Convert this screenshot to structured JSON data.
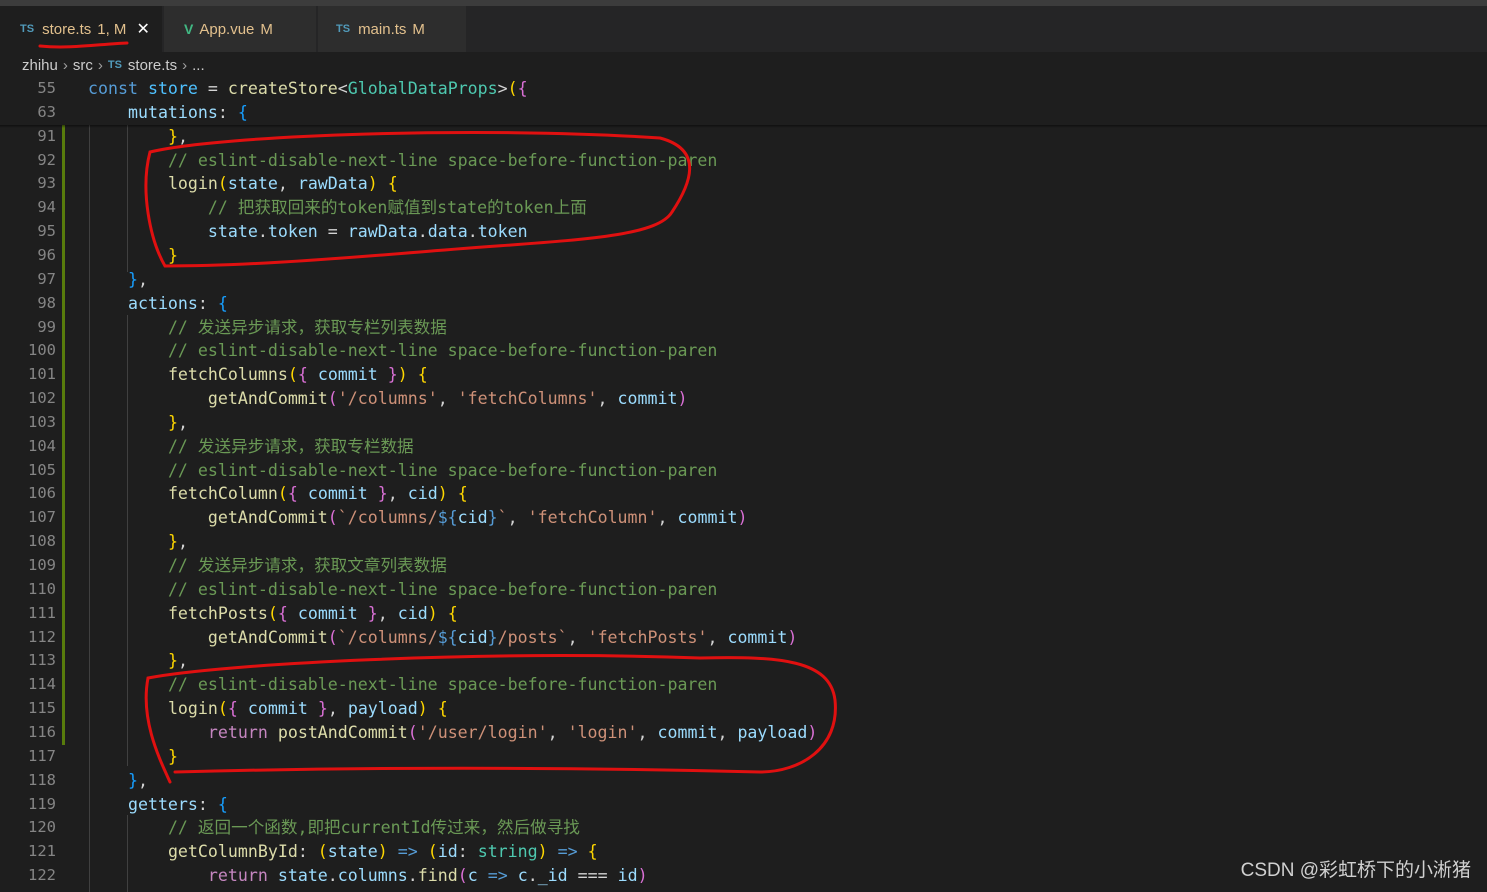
{
  "tabs": [
    {
      "icon": "TS",
      "name": "store.ts",
      "status": "1, M"
    },
    {
      "icon": "V",
      "name": "App.vue",
      "status": "M"
    },
    {
      "icon": "TS",
      "name": "main.ts",
      "status": "M"
    }
  ],
  "breadcrumb": {
    "project": "zhihu",
    "folder": "src",
    "file_icon": "TS",
    "file": "store.ts",
    "more": "..."
  },
  "lines": [
    {
      "n": "55",
      "t": [
        [
          "t-kw",
          "const"
        ],
        [
          "t-p",
          " "
        ],
        [
          "t-const",
          "store"
        ],
        [
          "t-p",
          " = "
        ],
        [
          "t-fn",
          "createStore"
        ],
        [
          "t-p",
          "<"
        ],
        [
          "t-type",
          "GlobalDataProps"
        ],
        [
          "t-p",
          ">"
        ],
        [
          "b1",
          "("
        ],
        [
          "b2",
          "{"
        ]
      ]
    },
    {
      "n": "63",
      "t": [
        [
          "t-p",
          "    "
        ],
        [
          "t-var",
          "mutations"
        ],
        [
          "t-p",
          ": "
        ],
        [
          "b3",
          "{"
        ]
      ]
    },
    {
      "n": "91",
      "t": [
        [
          "t-p",
          "        "
        ],
        [
          "b1",
          "}"
        ],
        [
          "t-p",
          ","
        ]
      ]
    },
    {
      "n": "92",
      "t": [
        [
          "t-p",
          "        "
        ],
        [
          "t-com",
          "// eslint-disable-next-line space-before-function-paren"
        ]
      ]
    },
    {
      "n": "93",
      "t": [
        [
          "t-p",
          "        "
        ],
        [
          "t-fn",
          "login"
        ],
        [
          "b1",
          "("
        ],
        [
          "t-var",
          "state"
        ],
        [
          "t-p",
          ", "
        ],
        [
          "t-var",
          "rawData"
        ],
        [
          "b1",
          ")"
        ],
        [
          "t-p",
          " "
        ],
        [
          "b1",
          "{"
        ]
      ]
    },
    {
      "n": "94",
      "t": [
        [
          "t-p",
          "            "
        ],
        [
          "t-com",
          "// 把获取回来的token赋值到state的token上面"
        ]
      ]
    },
    {
      "n": "95",
      "t": [
        [
          "t-p",
          "            "
        ],
        [
          "t-var",
          "state"
        ],
        [
          "t-p",
          "."
        ],
        [
          "t-var",
          "token"
        ],
        [
          "t-p",
          " = "
        ],
        [
          "t-var",
          "rawData"
        ],
        [
          "t-p",
          "."
        ],
        [
          "t-var",
          "data"
        ],
        [
          "t-p",
          "."
        ],
        [
          "t-var",
          "token"
        ]
      ]
    },
    {
      "n": "96",
      "t": [
        [
          "t-p",
          "        "
        ],
        [
          "b1",
          "}"
        ]
      ]
    },
    {
      "n": "97",
      "t": [
        [
          "t-p",
          "    "
        ],
        [
          "b3",
          "}"
        ],
        [
          "t-p",
          ","
        ]
      ]
    },
    {
      "n": "98",
      "t": [
        [
          "t-p",
          "    "
        ],
        [
          "t-var",
          "actions"
        ],
        [
          "t-p",
          ": "
        ],
        [
          "b3",
          "{"
        ]
      ]
    },
    {
      "n": "99",
      "t": [
        [
          "t-p",
          "        "
        ],
        [
          "t-com",
          "// 发送异步请求，获取专栏列表数据"
        ]
      ]
    },
    {
      "n": "100",
      "t": [
        [
          "t-p",
          "        "
        ],
        [
          "t-com",
          "// eslint-disable-next-line space-before-function-paren"
        ]
      ]
    },
    {
      "n": "101",
      "t": [
        [
          "t-p",
          "        "
        ],
        [
          "t-fn",
          "fetchColumns"
        ],
        [
          "b1",
          "("
        ],
        [
          "b2",
          "{"
        ],
        [
          "t-p",
          " "
        ],
        [
          "t-var",
          "commit"
        ],
        [
          "t-p",
          " "
        ],
        [
          "b2",
          "}"
        ],
        [
          "b1",
          ")"
        ],
        [
          "t-p",
          " "
        ],
        [
          "b1",
          "{"
        ]
      ]
    },
    {
      "n": "102",
      "t": [
        [
          "t-p",
          "            "
        ],
        [
          "t-fn",
          "getAndCommit"
        ],
        [
          "b2",
          "("
        ],
        [
          "t-str",
          "'/columns'"
        ],
        [
          "t-p",
          ", "
        ],
        [
          "t-str",
          "'fetchColumns'"
        ],
        [
          "t-p",
          ", "
        ],
        [
          "t-var",
          "commit"
        ],
        [
          "b2",
          ")"
        ]
      ]
    },
    {
      "n": "103",
      "t": [
        [
          "t-p",
          "        "
        ],
        [
          "b1",
          "}"
        ],
        [
          "t-p",
          ","
        ]
      ]
    },
    {
      "n": "104",
      "t": [
        [
          "t-p",
          "        "
        ],
        [
          "t-com",
          "// 发送异步请求，获取专栏数据"
        ]
      ]
    },
    {
      "n": "105",
      "t": [
        [
          "t-p",
          "        "
        ],
        [
          "t-com",
          "// eslint-disable-next-line space-before-function-paren"
        ]
      ]
    },
    {
      "n": "106",
      "t": [
        [
          "t-p",
          "        "
        ],
        [
          "t-fn",
          "fetchColumn"
        ],
        [
          "b1",
          "("
        ],
        [
          "b2",
          "{"
        ],
        [
          "t-p",
          " "
        ],
        [
          "t-var",
          "commit"
        ],
        [
          "t-p",
          " "
        ],
        [
          "b2",
          "}"
        ],
        [
          "t-p",
          ", "
        ],
        [
          "t-var",
          "cid"
        ],
        [
          "b1",
          ")"
        ],
        [
          "t-p",
          " "
        ],
        [
          "b1",
          "{"
        ]
      ]
    },
    {
      "n": "107",
      "t": [
        [
          "t-p",
          "            "
        ],
        [
          "t-fn",
          "getAndCommit"
        ],
        [
          "b2",
          "("
        ],
        [
          "t-str",
          "`/columns/"
        ],
        [
          "t-kw",
          "${"
        ],
        [
          "t-var",
          "cid"
        ],
        [
          "t-kw",
          "}"
        ],
        [
          "t-str",
          "`"
        ],
        [
          "t-p",
          ", "
        ],
        [
          "t-str",
          "'fetchColumn'"
        ],
        [
          "t-p",
          ", "
        ],
        [
          "t-var",
          "commit"
        ],
        [
          "b2",
          ")"
        ]
      ]
    },
    {
      "n": "108",
      "t": [
        [
          "t-p",
          "        "
        ],
        [
          "b1",
          "}"
        ],
        [
          "t-p",
          ","
        ]
      ]
    },
    {
      "n": "109",
      "t": [
        [
          "t-p",
          "        "
        ],
        [
          "t-com",
          "// 发送异步请求，获取文章列表数据"
        ]
      ]
    },
    {
      "n": "110",
      "t": [
        [
          "t-p",
          "        "
        ],
        [
          "t-com",
          "// eslint-disable-next-line space-before-function-paren"
        ]
      ]
    },
    {
      "n": "111",
      "t": [
        [
          "t-p",
          "        "
        ],
        [
          "t-fn",
          "fetchPosts"
        ],
        [
          "b1",
          "("
        ],
        [
          "b2",
          "{"
        ],
        [
          "t-p",
          " "
        ],
        [
          "t-var",
          "commit"
        ],
        [
          "t-p",
          " "
        ],
        [
          "b2",
          "}"
        ],
        [
          "t-p",
          ", "
        ],
        [
          "t-var",
          "cid"
        ],
        [
          "b1",
          ")"
        ],
        [
          "t-p",
          " "
        ],
        [
          "b1",
          "{"
        ]
      ]
    },
    {
      "n": "112",
      "t": [
        [
          "t-p",
          "            "
        ],
        [
          "t-fn",
          "getAndCommit"
        ],
        [
          "b2",
          "("
        ],
        [
          "t-str",
          "`/columns/"
        ],
        [
          "t-kw",
          "${"
        ],
        [
          "t-var",
          "cid"
        ],
        [
          "t-kw",
          "}"
        ],
        [
          "t-str",
          "/posts`"
        ],
        [
          "t-p",
          ", "
        ],
        [
          "t-str",
          "'fetchPosts'"
        ],
        [
          "t-p",
          ", "
        ],
        [
          "t-var",
          "commit"
        ],
        [
          "b2",
          ")"
        ]
      ]
    },
    {
      "n": "113",
      "t": [
        [
          "t-p",
          "        "
        ],
        [
          "b1",
          "}"
        ],
        [
          "t-p",
          ","
        ]
      ]
    },
    {
      "n": "114",
      "t": [
        [
          "t-p",
          "        "
        ],
        [
          "t-com",
          "// eslint-disable-next-line space-before-function-paren"
        ]
      ]
    },
    {
      "n": "115",
      "t": [
        [
          "t-p",
          "        "
        ],
        [
          "t-fn",
          "login"
        ],
        [
          "b1",
          "("
        ],
        [
          "b2",
          "{"
        ],
        [
          "t-p",
          " "
        ],
        [
          "t-var",
          "commit"
        ],
        [
          "t-p",
          " "
        ],
        [
          "b2",
          "}"
        ],
        [
          "t-p",
          ", "
        ],
        [
          "t-var",
          "payload"
        ],
        [
          "b1",
          ")"
        ],
        [
          "t-p",
          " "
        ],
        [
          "b1",
          "{"
        ]
      ]
    },
    {
      "n": "116",
      "t": [
        [
          "t-p",
          "            "
        ],
        [
          "t-ctrl",
          "return"
        ],
        [
          "t-p",
          " "
        ],
        [
          "t-fn",
          "postAndCommit"
        ],
        [
          "b2",
          "("
        ],
        [
          "t-str",
          "'/user/login'"
        ],
        [
          "t-p",
          ", "
        ],
        [
          "t-str",
          "'login'"
        ],
        [
          "t-p",
          ", "
        ],
        [
          "t-var",
          "commit"
        ],
        [
          "t-p",
          ", "
        ],
        [
          "t-var",
          "payload"
        ],
        [
          "b2",
          ")"
        ]
      ]
    },
    {
      "n": "117",
      "t": [
        [
          "t-p",
          "        "
        ],
        [
          "b1",
          "}"
        ]
      ]
    },
    {
      "n": "118",
      "t": [
        [
          "t-p",
          "    "
        ],
        [
          "b3",
          "}"
        ],
        [
          "t-p",
          ","
        ]
      ]
    },
    {
      "n": "119",
      "t": [
        [
          "t-p",
          "    "
        ],
        [
          "t-var",
          "getters"
        ],
        [
          "t-p",
          ": "
        ],
        [
          "b3",
          "{"
        ]
      ]
    },
    {
      "n": "120",
      "t": [
        [
          "t-p",
          "        "
        ],
        [
          "t-com",
          "// 返回一个函数,即把currentId传过来，然后做寻找"
        ]
      ]
    },
    {
      "n": "121",
      "t": [
        [
          "t-p",
          "        "
        ],
        [
          "t-fn",
          "getColumnById"
        ],
        [
          "t-p",
          ": "
        ],
        [
          "b1",
          "("
        ],
        [
          "t-var",
          "state"
        ],
        [
          "b1",
          ")"
        ],
        [
          "t-p",
          " "
        ],
        [
          "t-kw",
          "=>"
        ],
        [
          "t-p",
          " "
        ],
        [
          "b1",
          "("
        ],
        [
          "t-var",
          "id"
        ],
        [
          "t-p",
          ": "
        ],
        [
          "t-type",
          "string"
        ],
        [
          "b1",
          ")"
        ],
        [
          "t-p",
          " "
        ],
        [
          "t-kw",
          "=>"
        ],
        [
          "t-p",
          " "
        ],
        [
          "b1",
          "{"
        ]
      ]
    },
    {
      "n": "122",
      "t": [
        [
          "t-p",
          "            "
        ],
        [
          "t-ctrl",
          "return"
        ],
        [
          "t-p",
          " "
        ],
        [
          "t-var",
          "state"
        ],
        [
          "t-p",
          "."
        ],
        [
          "t-var",
          "columns"
        ],
        [
          "t-p",
          "."
        ],
        [
          "t-fn",
          "find"
        ],
        [
          "b2",
          "("
        ],
        [
          "t-var",
          "c"
        ],
        [
          "t-p",
          " "
        ],
        [
          "t-kw",
          "=>"
        ],
        [
          "t-p",
          " "
        ],
        [
          "t-var",
          "c"
        ],
        [
          "t-p",
          "."
        ],
        [
          "t-var",
          "_id"
        ],
        [
          "t-p",
          " === "
        ],
        [
          "t-var",
          "id"
        ],
        [
          "b2",
          ")"
        ]
      ]
    }
  ],
  "watermark": "CSDN @彩虹桥下的小淅猪",
  "colors": {
    "editor_bg": "#1e1e1e",
    "tabbar_bg": "#252526",
    "annotation": "#e01010",
    "modified": "#e2c08d"
  }
}
